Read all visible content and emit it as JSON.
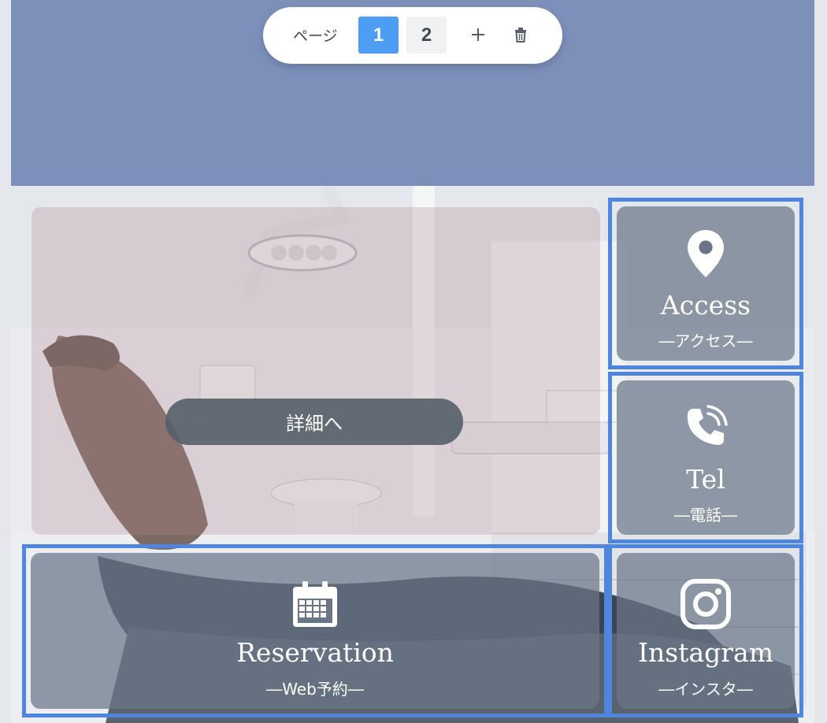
{
  "pager": {
    "label": "ページ",
    "pages": [
      "1",
      "2"
    ],
    "active_page": "1",
    "add_icon": "plus-icon",
    "delete_icon": "trash-icon"
  },
  "colors": {
    "header": "#7d90b9",
    "accent": "#4e9df5",
    "tile_outline": "#4e86df"
  },
  "hero": {
    "button_label": "詳細へ"
  },
  "tiles": [
    {
      "icon": "map-pin-icon",
      "title": "Access",
      "subtitle": "―アクセス―"
    },
    {
      "icon": "phone-icon",
      "title": "Tel",
      "subtitle": "―電話―"
    },
    {
      "icon": "calendar-icon",
      "title": "Reservation",
      "subtitle": "―Web予約―"
    },
    {
      "icon": "instagram-icon",
      "title": "Instagram",
      "subtitle": "―インスタ―"
    }
  ]
}
